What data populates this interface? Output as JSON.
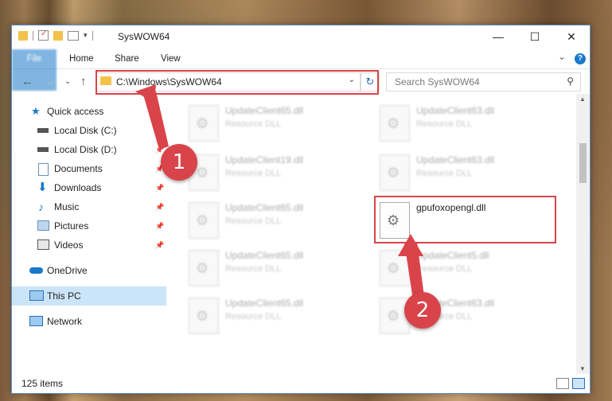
{
  "window": {
    "title": "SysWOW64",
    "controls": {
      "minimize": "—",
      "maximize": "☐",
      "close": "✕"
    }
  },
  "ribbon": {
    "tabs": [
      "File",
      "Home",
      "Share",
      "View"
    ],
    "expand_label": "⌄",
    "help_label": "?"
  },
  "nav": {
    "back": "←",
    "forward": "→",
    "recent": "⌄",
    "up": "↑",
    "address": "C:\\Windows\\SysWOW64",
    "refresh": "↻",
    "search_placeholder": "Search SysWOW64"
  },
  "sidebar": {
    "items": [
      {
        "label": "Quick access",
        "icon": "star-icon",
        "pinned": false
      },
      {
        "label": "Local Disk (C:)",
        "icon": "drive-icon",
        "pinned": true
      },
      {
        "label": "Local Disk (D:)",
        "icon": "drive-icon",
        "pinned": true
      },
      {
        "label": "Documents",
        "icon": "documents-icon",
        "pinned": true
      },
      {
        "label": "Downloads",
        "icon": "download-icon",
        "pinned": true
      },
      {
        "label": "Music",
        "icon": "music-icon",
        "pinned": true
      },
      {
        "label": "Pictures",
        "icon": "pictures-icon",
        "pinned": true
      },
      {
        "label": "Videos",
        "icon": "videos-icon",
        "pinned": true
      },
      {
        "label": "OneDrive",
        "icon": "cloud-icon",
        "pinned": false
      },
      {
        "label": "This PC",
        "icon": "computer-icon",
        "pinned": false,
        "selected": true
      },
      {
        "label": "Network",
        "icon": "network-icon",
        "pinned": false
      }
    ]
  },
  "files": [
    {
      "name": "UpdateClient65.dll",
      "desc": "Resource DLL"
    },
    {
      "name": "UpdateClient63.dll",
      "desc": "Resource DLL"
    },
    {
      "name": "UpdateClient19.dll",
      "desc": "Resource DLL"
    },
    {
      "name": "UpdateClient63.dll",
      "desc": "Resource DLL"
    },
    {
      "name": "UpdateClient65.dll",
      "desc": "Resource DLL"
    },
    {
      "name": "gpufoxopengl.dll",
      "desc": ""
    },
    {
      "name": "UpdateClient65.dll",
      "desc": "Resource DLL"
    },
    {
      "name": "UpdateClient5.dll",
      "desc": "Resource DLL"
    },
    {
      "name": "UpdateClient65.dll",
      "desc": "Resource DLL"
    },
    {
      "name": "UpdateClient63.dll",
      "desc": "Resource DLL"
    }
  ],
  "status": {
    "item_count": "125 items"
  },
  "annotations": {
    "step1": "1",
    "step2": "2",
    "highlight_color": "#d9444a"
  }
}
